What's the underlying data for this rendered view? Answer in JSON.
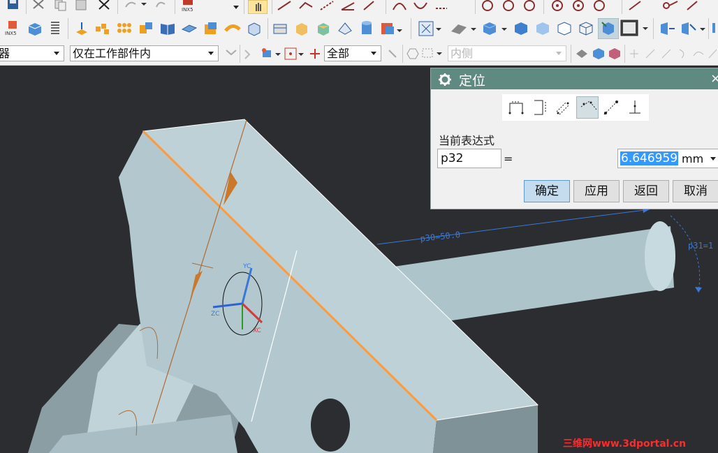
{
  "toolbar": {
    "row1_icons": [
      "save-icon",
      "cut-icon",
      "copy-icon",
      "paste-icon",
      "delete-icon",
      "undo-icon",
      "redo-icon",
      "inx5-icon",
      "select-hand-icon",
      "line-icon",
      "polyline-icon",
      "dashed-line-icon",
      "angle-line-icon",
      "arc-icon",
      "arc2-icon",
      "trim-icon",
      "circle-icon",
      "circle2-icon",
      "circle3-icon",
      "point-circle-icon",
      "point-circle2-icon",
      "point-circle3-icon",
      "line-point-icon",
      "connect-icon",
      "diag-line-icon"
    ],
    "inx5_label": "INX5",
    "row2_icons": [
      "inx5-part-icon",
      "block-icon",
      "spring-icon",
      "extrude-icon",
      "array-icon",
      "multi-block-icon",
      "assembly-icon",
      "book-icon",
      "sheet-icon",
      "flange-icon",
      "sweep-icon",
      "cube-wire-icon",
      "box-icon",
      "face-icon",
      "shaded-face-icon",
      "prism-icon",
      "cylinder-icon",
      "color-block-icon",
      "snap-view-icon",
      "view-orient-icon",
      "solid-cube-icon",
      "cube-icon",
      "shaded-cube-icon",
      "wire-cube-icon",
      "iso-cube-icon",
      "active-view-icon",
      "color-swatch-icon",
      "move-icon",
      "reflect-icon"
    ],
    "row3": {
      "filter_combo": {
        "value": "器"
      },
      "scope_combo": {
        "value": "仅在工作部件内"
      },
      "type_combo": {
        "value": "全部"
      },
      "face_combo": {
        "value": "内侧"
      }
    }
  },
  "dialog": {
    "title": "定位",
    "title_icon": "gear-icon",
    "close_glyph": "×",
    "method_icons": [
      "horizontal-dim-icon",
      "vertical-dim-icon",
      "parallel-dim-icon",
      "perpendicular-dim-icon",
      "point-onto-point-icon",
      "point-onto-line-icon"
    ],
    "selected_method_index": 3,
    "expression_label": "当前表达式",
    "expression_name": "p32",
    "equals": "=",
    "expression_value": "6.646959",
    "unit": "mm",
    "buttons": {
      "ok": "确定",
      "apply": "应用",
      "back": "返回",
      "cancel": "取消"
    }
  },
  "viewport": {
    "dim_labels": {
      "p30": "p30=50.0",
      "p31": "p31=1"
    },
    "triad_labels": {
      "x": "XC",
      "y": "YC",
      "z": "ZC"
    }
  },
  "watermark": "三维网www.3dportal.cn",
  "colors": {
    "toolbar_bg": "#f2f2f2",
    "viewport_bg": "#2b2d31",
    "dialog_header": "#5e8a82",
    "part_face": "#b8ccd1",
    "edge_highlight": "#ff9a3c",
    "dimension": "#3a78d8",
    "selection_blue": "#3399ff"
  }
}
